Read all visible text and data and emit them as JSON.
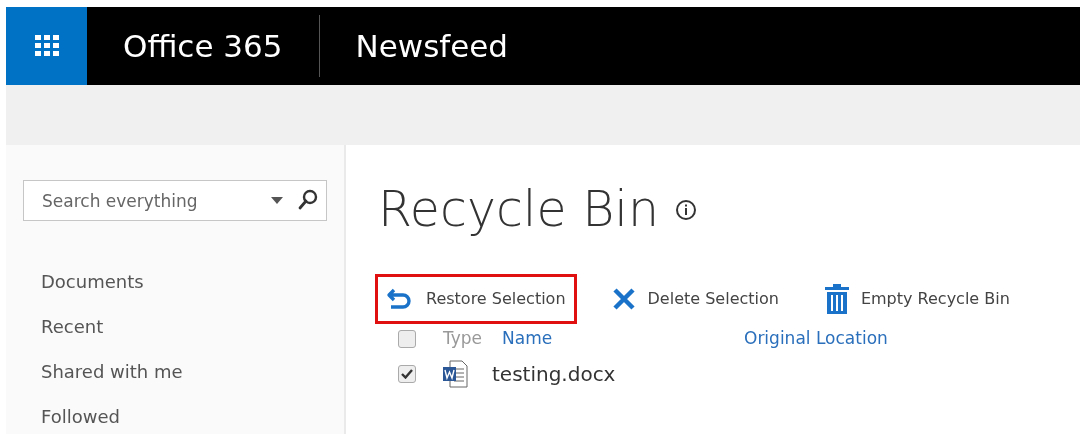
{
  "suite_bar": {
    "brand": "Office 365",
    "app": "Newsfeed"
  },
  "search": {
    "placeholder": "Search everything"
  },
  "nav": [
    {
      "label": "Documents"
    },
    {
      "label": "Recent"
    },
    {
      "label": "Shared with me"
    },
    {
      "label": "Followed"
    }
  ],
  "page": {
    "title": "Recycle Bin"
  },
  "toolbar": [
    {
      "kind": "restore",
      "label": "Restore Selection",
      "highlighted": true
    },
    {
      "kind": "delete",
      "label": "Delete Selection",
      "highlighted": false
    },
    {
      "kind": "empty",
      "label": "Empty Recycle Bin",
      "highlighted": false
    }
  ],
  "table": {
    "columns": [
      {
        "label": "Type",
        "sortable": false
      },
      {
        "label": "Name",
        "sortable": true
      },
      {
        "label": "Original Location",
        "sortable": true
      }
    ],
    "header_checked": false,
    "rows": [
      {
        "name": "testing.docx",
        "checked": true
      }
    ]
  }
}
